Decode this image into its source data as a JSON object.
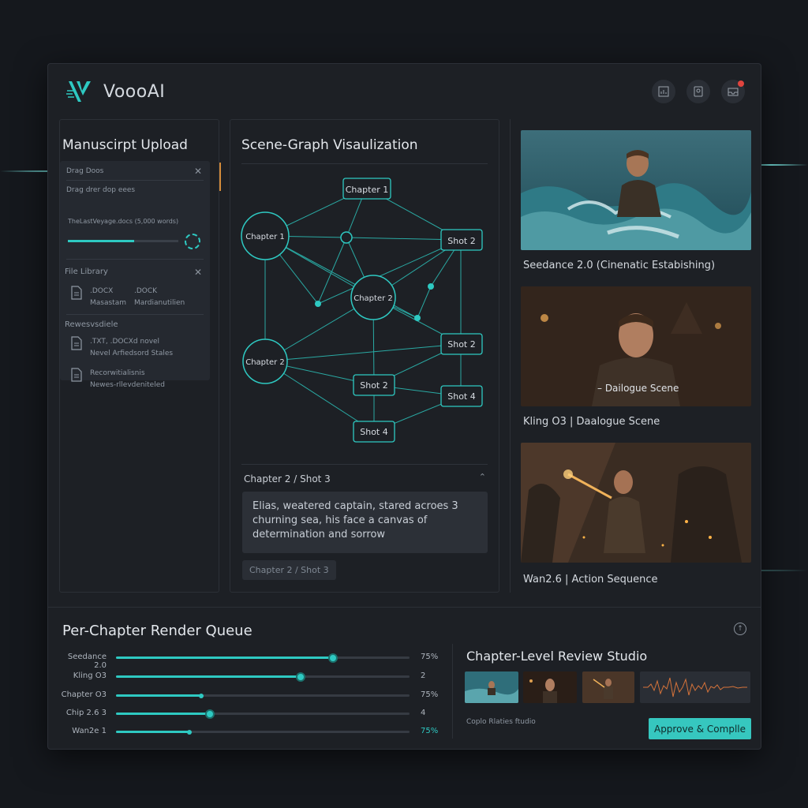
{
  "app": {
    "name": "VoooAI"
  },
  "colors": {
    "accent": "#2ec9c2",
    "panel": "#1d2025",
    "card": "#252930",
    "warning": "#d38b3a"
  },
  "header": {
    "icons": [
      "chart-icon",
      "badge-icon",
      "inbox-icon"
    ]
  },
  "upload": {
    "title": "Manuscirpt Upload",
    "drag_label": "Drag Doos",
    "drop_hint": "Drag drer dop eees",
    "file_name": "TheLastVeyage.docs (5,000 words)",
    "progress": 0.6,
    "library_label": "File Library",
    "library_files": [
      {
        "line1": ".DOCX",
        "line2": "Masastam"
      },
      {
        "line1": ".DOCK",
        "line2": "Mardianutilien"
      }
    ],
    "recent_label": "Rewesvsdiele",
    "recent_files": [
      {
        "line1": ".TXT, .DOCXd novel",
        "line2": "Nevel Arfiedsord Stales"
      },
      {
        "line1": "Recorwitialisnis",
        "line2": "Newes-rllevdeniteled"
      }
    ]
  },
  "graph": {
    "title": "Scene-Graph Visaulization",
    "nodes": {
      "chapter1_top": "Chapter 1",
      "chapter1_circle": "Chapter 1",
      "chapter2_center": "Chapter 2",
      "chapter2_left": "Chapter 2",
      "shot2_right": "Shot 2",
      "shot2_mid": "Shot 2",
      "shot2_low": "Shot 2",
      "shot4_right": "Shot 4",
      "shot4_bottom": "Shot 4"
    },
    "detail_heading": "Chapter 2 / Shot 3",
    "detail_text": "Elias, weatered captain, stared acroes 3 churning sea, his face a canvas of determination and sorrow",
    "detail_chip": "Chapter 2 / Shot 3"
  },
  "previews": [
    {
      "caption": "Seedance 2.0 (Cinenatic Estabishing)"
    },
    {
      "caption": "Kling O3 | Daalogue Scene",
      "overlay": "– Dailogue Scene"
    },
    {
      "caption": "Wan2.6 | Action Sequence"
    }
  ],
  "queue": {
    "title": "Per-Chapter Render Queue",
    "rows": [
      {
        "label": "Seedance 2.0",
        "progress": 0.74,
        "value": "75%",
        "accent": false
      },
      {
        "label": "Kling O3",
        "progress": 0.63,
        "value": "2",
        "accent": false
      },
      {
        "label": "Chapter O3",
        "progress": 0.29,
        "value": "75%",
        "accent": false
      },
      {
        "label": "Chip 2.6 3",
        "progress": 0.32,
        "value": "4",
        "accent": false
      },
      {
        "label": "Wan2e 1",
        "progress": 0.25,
        "value": "75%",
        "accent": true
      }
    ]
  },
  "review": {
    "title": "Chapter-Level Review Studio",
    "note": "Coplo Rlaties ftudio",
    "approve_label": "Approve & Complle"
  }
}
